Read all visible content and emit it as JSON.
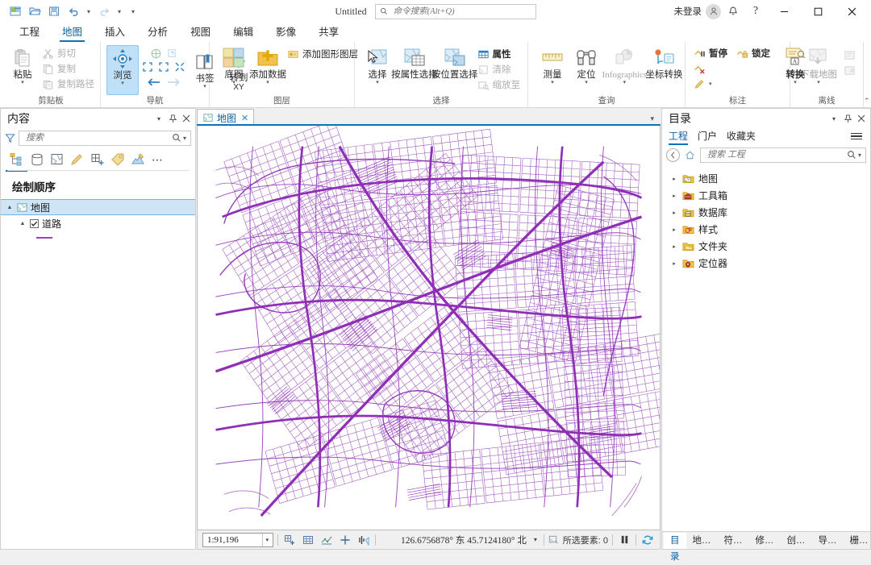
{
  "titlebar": {
    "quick_access": [
      {
        "name": "new-project-icon",
        "label": "新建工程"
      },
      {
        "name": "open-project-icon",
        "label": "打开工程"
      },
      {
        "name": "save-project-icon",
        "label": "保存工程"
      },
      {
        "name": "undo-icon",
        "label": "撤消"
      },
      {
        "name": "redo-icon",
        "label": "恢复"
      },
      {
        "name": "customize-qat-icon",
        "label": "自定义快速访问工具栏"
      }
    ],
    "document_title": "Untitled",
    "search_placeholder": "命令搜索(Alt+Q)",
    "sign_in_label": "未登录",
    "notification_label": "通知",
    "help_label": "帮助",
    "minimize_label": "最小化",
    "maximize_label": "最大化",
    "close_label": "关闭"
  },
  "ribbon": {
    "tabs": [
      {
        "label": "工程",
        "active": false
      },
      {
        "label": "地图",
        "active": true
      },
      {
        "label": "插入",
        "active": false
      },
      {
        "label": "分析",
        "active": false
      },
      {
        "label": "视图",
        "active": false
      },
      {
        "label": "编辑",
        "active": false
      },
      {
        "label": "影像",
        "active": false
      },
      {
        "label": "共享",
        "active": false
      }
    ],
    "groups": {
      "clipboard": {
        "label": "剪贴板",
        "paste": "粘贴",
        "cut": "剪切",
        "copy": "复制",
        "copy_path": "复制路径"
      },
      "navigate": {
        "label": "导航",
        "explore": "浏览",
        "bookmarks": "书签",
        "goto_xy_line1": "转到",
        "goto_xy_line2": "XY"
      },
      "layer": {
        "label": "图层",
        "basemap": "底图",
        "add_data": "添加数据",
        "add_graphics_layer": "添加图形图层"
      },
      "selection": {
        "label": "选择",
        "select": "选择",
        "select_by_attributes": "按属性选择",
        "select_by_location": "按位置选择",
        "attributes": "属性",
        "clear": "清除",
        "zoom_to": "缩放至"
      },
      "inquiry": {
        "label": "查询",
        "measure": "测量",
        "locate": "定位",
        "infographics": "Infographics",
        "coordinate_conversion": "坐标转换"
      },
      "labeling": {
        "label": "标注",
        "pause": "暂停",
        "lock": "锁定",
        "convert": "转换"
      },
      "offline": {
        "label": "离线",
        "download_map": "下载地图"
      }
    }
  },
  "contents_pane": {
    "title": "内容",
    "search_placeholder": "搜索",
    "toolbar_icons": [
      {
        "name": "list-by-drawing-order-icon",
        "active": true
      },
      {
        "name": "list-by-data-source-icon",
        "active": false
      },
      {
        "name": "list-by-selection-icon",
        "active": false
      },
      {
        "name": "list-by-editing-icon",
        "active": false
      },
      {
        "name": "list-by-snapping-icon",
        "active": false
      },
      {
        "name": "list-by-labeling-icon",
        "active": false
      },
      {
        "name": "list-by-symbology-icon",
        "active": false
      },
      {
        "name": "more-options-icon",
        "active": false
      }
    ],
    "section_header": "绘制顺序",
    "map_node": "地图",
    "layers": [
      {
        "label": "道路",
        "checked": true,
        "symbol_color": "#9b3fc4"
      }
    ]
  },
  "map_view": {
    "tab_label": "地图",
    "tab_close": "✕",
    "background_color": "#ffffff",
    "road_color": "#8e2fb5"
  },
  "status_bar": {
    "scale": "1:91,196",
    "tool_icons": [
      {
        "name": "add-bookmark-icon"
      },
      {
        "name": "open-bookmarks-icon"
      },
      {
        "name": "map-scale-properties-icon"
      },
      {
        "name": "add-location-icon"
      },
      {
        "name": "navigation-mode-icon"
      }
    ],
    "coordinates": "126.6756878° 东  45.7124180° 北",
    "selected_features_label": "所选要素: 0",
    "pause_drawing_label": "暂停绘制",
    "refresh_label": "刷新"
  },
  "catalog_pane": {
    "title": "目录",
    "tabs": [
      {
        "label": "工程",
        "active": true
      },
      {
        "label": "门户",
        "active": false
      },
      {
        "label": "收藏夹",
        "active": false
      }
    ],
    "search_placeholder": "搜索 工程",
    "items": [
      {
        "label": "地图",
        "icon": "map-folder-icon",
        "color": "#d4a017"
      },
      {
        "label": "工具箱",
        "icon": "toolbox-folder-icon",
        "color": "#d4a017"
      },
      {
        "label": "数据库",
        "icon": "database-folder-icon",
        "color": "#d4a017"
      },
      {
        "label": "样式",
        "icon": "styles-folder-icon",
        "color": "#d4a017"
      },
      {
        "label": "文件夹",
        "icon": "folders-folder-icon",
        "color": "#d4a017"
      },
      {
        "label": "定位器",
        "icon": "locator-folder-icon",
        "color": "#d4a017"
      }
    ]
  },
  "bottom_tabs": [
    {
      "label": "目录",
      "active": true
    },
    {
      "label": "地…",
      "active": false
    },
    {
      "label": "符…",
      "active": false
    },
    {
      "label": "修…",
      "active": false
    },
    {
      "label": "创…",
      "active": false
    },
    {
      "label": "导…",
      "active": false
    },
    {
      "label": "栅…",
      "active": false
    }
  ]
}
